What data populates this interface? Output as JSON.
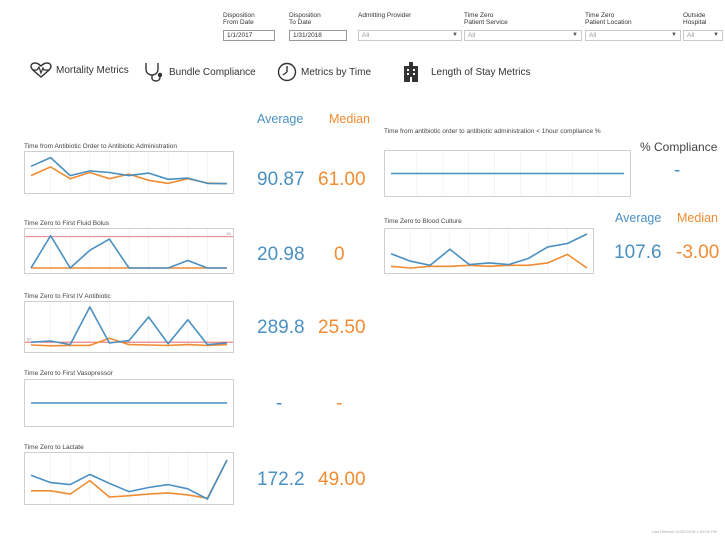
{
  "filters": [
    {
      "label": "Disposition\nFrom Date",
      "value": "1/1/2017",
      "kind": "input"
    },
    {
      "label": "Disposition\nTo Date",
      "value": "1/31/2018",
      "kind": "input"
    },
    {
      "label": "Admitting Provider",
      "value": "All",
      "kind": "select"
    },
    {
      "label": "Time Zero\nPatient Service",
      "value": "All",
      "kind": "select"
    },
    {
      "label": "Time Zero\nPatient Location",
      "value": "All",
      "kind": "select"
    },
    {
      "label": "Outside\nHospital",
      "value": "All",
      "kind": "select"
    }
  ],
  "tabs": [
    {
      "label": "Mortality Metrics",
      "icon": "heart-pulse-icon"
    },
    {
      "label": "Bundle Compliance",
      "icon": "stethoscope-icon"
    },
    {
      "label": "Metrics by Time",
      "icon": "clock-icon"
    },
    {
      "label": "Length of Stay Metrics",
      "icon": "hospital-building-icon"
    }
  ],
  "headers": {
    "average": "Average",
    "median": "Median"
  },
  "colors": {
    "average": "#4a90c2",
    "median": "#f08c32",
    "reference": "#e05555"
  },
  "metrics_left": [
    {
      "title": "Time from Antibiotic Order to Antibiotic Administration",
      "average": "90.87",
      "median": "61.00"
    },
    {
      "title": "Time Zero to First Fluid Bolus",
      "average": "20.98",
      "median": "0",
      "ref_label": "60"
    },
    {
      "title": "Time Zero to First IV Antibiotic",
      "average": "289.8",
      "median": "25.50",
      "ref_label": "60"
    },
    {
      "title": "Time Zero to First Vasopressor",
      "average": "-",
      "median": "-"
    },
    {
      "title": "Time Zero to Lactate",
      "average": "172.2",
      "median": "49.00"
    }
  ],
  "compliance": {
    "title": "Time from antibiotic order to antibiotic administration < 1hour compliance %",
    "label": "% Compliance",
    "value": "-"
  },
  "blood_culture": {
    "title": "Time Zero to Blood Culture",
    "average_header": "Average",
    "median_header": "Median",
    "average": "107.6",
    "median": "-3.00"
  },
  "sparklines": {
    "abx_order": {
      "avg": [
        70,
        98,
        40,
        55,
        50,
        40,
        48,
        28,
        32,
        15,
        14
      ],
      "med": [
        40,
        68,
        30,
        50,
        30,
        45,
        25,
        15,
        30,
        16,
        14
      ]
    },
    "fluid": {
      "avg": [
        0,
        95,
        0,
        52,
        85,
        0,
        0,
        0,
        22,
        0,
        0
      ],
      "med": [
        0,
        0,
        0,
        0,
        0,
        0,
        0,
        0,
        0,
        0,
        0
      ],
      "ref": 92
    },
    "iv_abx": {
      "avg": [
        12,
        15,
        6,
        100,
        10,
        16,
        75,
        8,
        68,
        6,
        10
      ],
      "med": [
        5,
        3,
        4,
        4,
        22,
        6,
        5,
        4,
        6,
        4,
        6
      ],
      "ref": 12
    },
    "vasopressor": {
      "avg": [
        50,
        50,
        50,
        50,
        50,
        50,
        50,
        50,
        50,
        50,
        50
      ]
    },
    "lactate": {
      "avg": [
        58,
        40,
        35,
        60,
        38,
        18,
        28,
        35,
        25,
        0,
        95
      ],
      "med": [
        20,
        20,
        12,
        45,
        5,
        8,
        12,
        15,
        10,
        2,
        95
      ]
    },
    "compliance": {
      "avg": [
        50,
        50,
        50,
        50,
        50,
        50,
        50,
        50,
        50,
        50
      ]
    },
    "blood_culture": {
      "avg": [
        42,
        20,
        8,
        55,
        10,
        15,
        10,
        28,
        62,
        72,
        100
      ],
      "med": [
        5,
        0,
        5,
        5,
        8,
        5,
        8,
        8,
        15,
        40,
        0
      ]
    }
  },
  "footer": "Last Refresh 01/02/2018 1:00:00 PM"
}
